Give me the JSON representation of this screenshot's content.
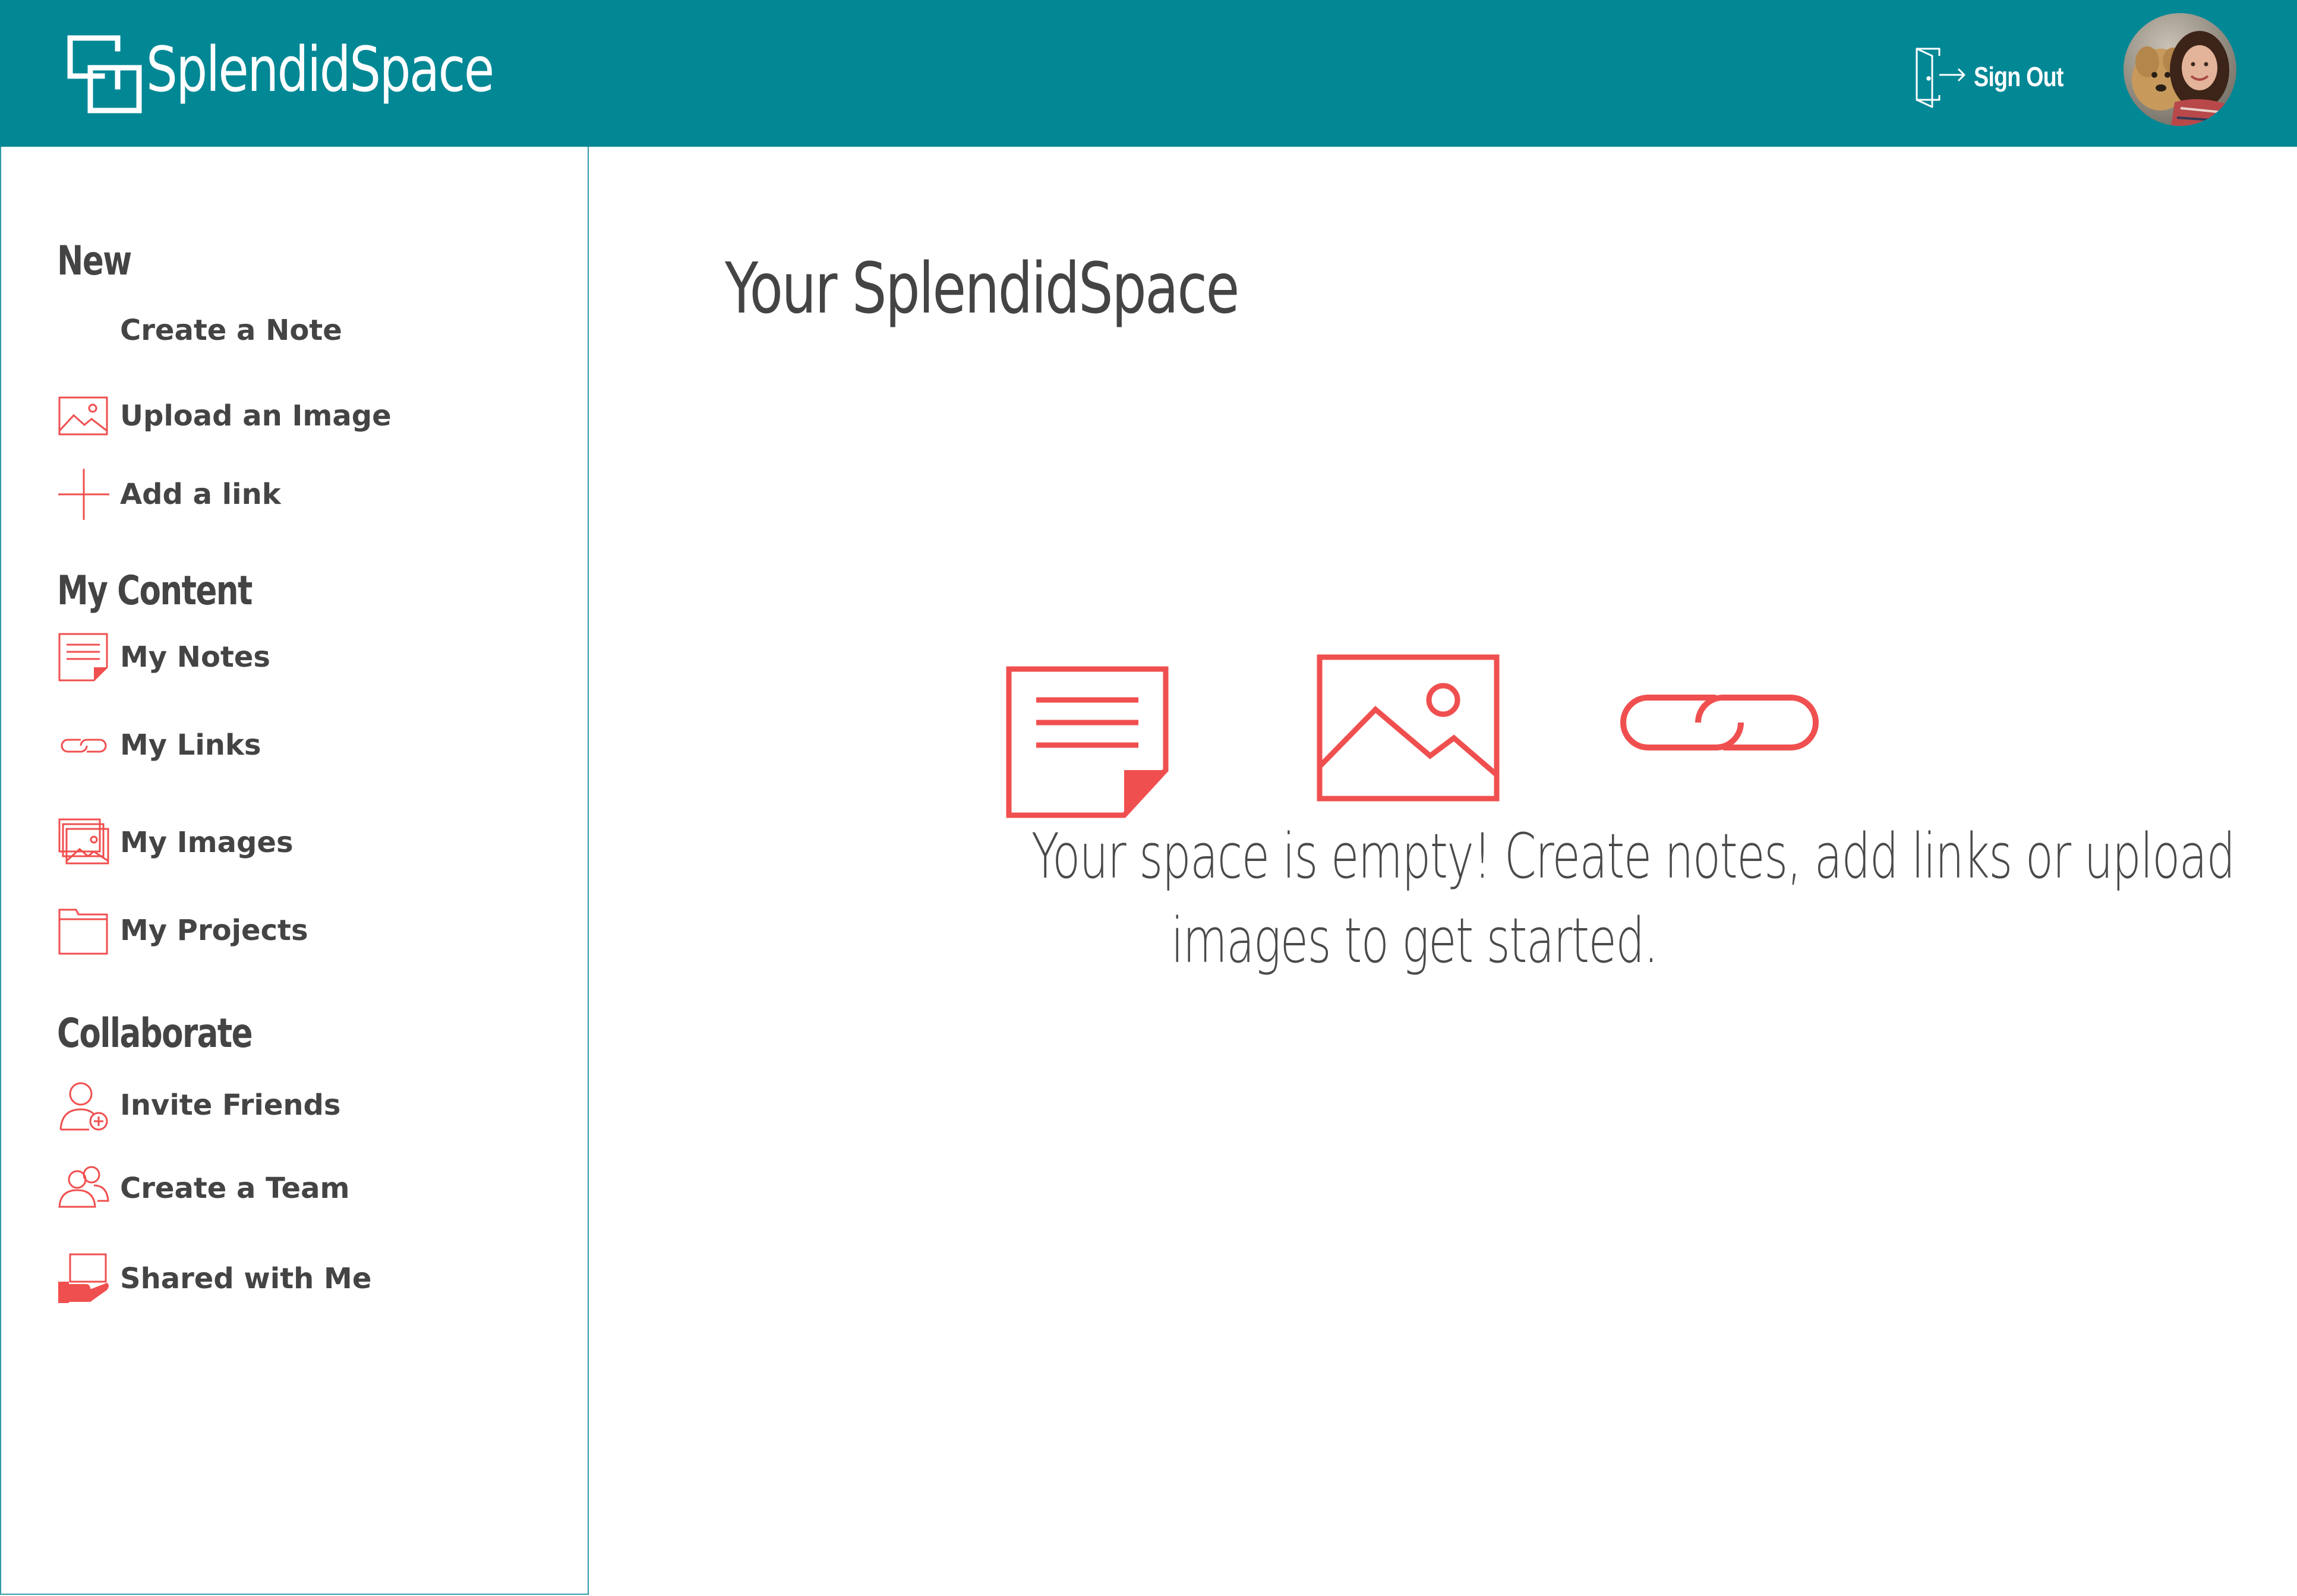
{
  "app": {
    "brand": "SplendidSpace",
    "accent_color": "#F04F4F",
    "header_color": "#028795"
  },
  "header": {
    "signout_label": "Sign Out",
    "signout_icon": "door-exit-icon",
    "avatar_alt": "User avatar with dog"
  },
  "sidebar": {
    "sections": {
      "new": {
        "heading": "New",
        "items": [
          {
            "label": "Create a Note",
            "icon": "none"
          },
          {
            "label": "Upload an Image",
            "icon": "image-icon"
          },
          {
            "label": "Add a link",
            "icon": "plus-icon"
          }
        ]
      },
      "my_content": {
        "heading": "My Content",
        "items": [
          {
            "label": "My Notes",
            "icon": "note-icon"
          },
          {
            "label": "My Links",
            "icon": "link-icon"
          },
          {
            "label": "My Images",
            "icon": "images-stack-icon"
          },
          {
            "label": "My Projects",
            "icon": "folder-icon"
          }
        ]
      },
      "collaborate": {
        "heading": "Collaborate",
        "items": [
          {
            "label": "Invite Friends",
            "icon": "add-user-icon"
          },
          {
            "label": "Create a Team",
            "icon": "team-icon"
          },
          {
            "label": "Shared with Me",
            "icon": "shared-hand-icon"
          }
        ]
      }
    }
  },
  "main": {
    "title": "Your SplendidSpace",
    "empty_state": {
      "line1": "Your space is empty! Create notes, add links or upload",
      "line2": "images to get started.",
      "icons": [
        "note-icon",
        "image-icon",
        "link-icon"
      ]
    }
  }
}
